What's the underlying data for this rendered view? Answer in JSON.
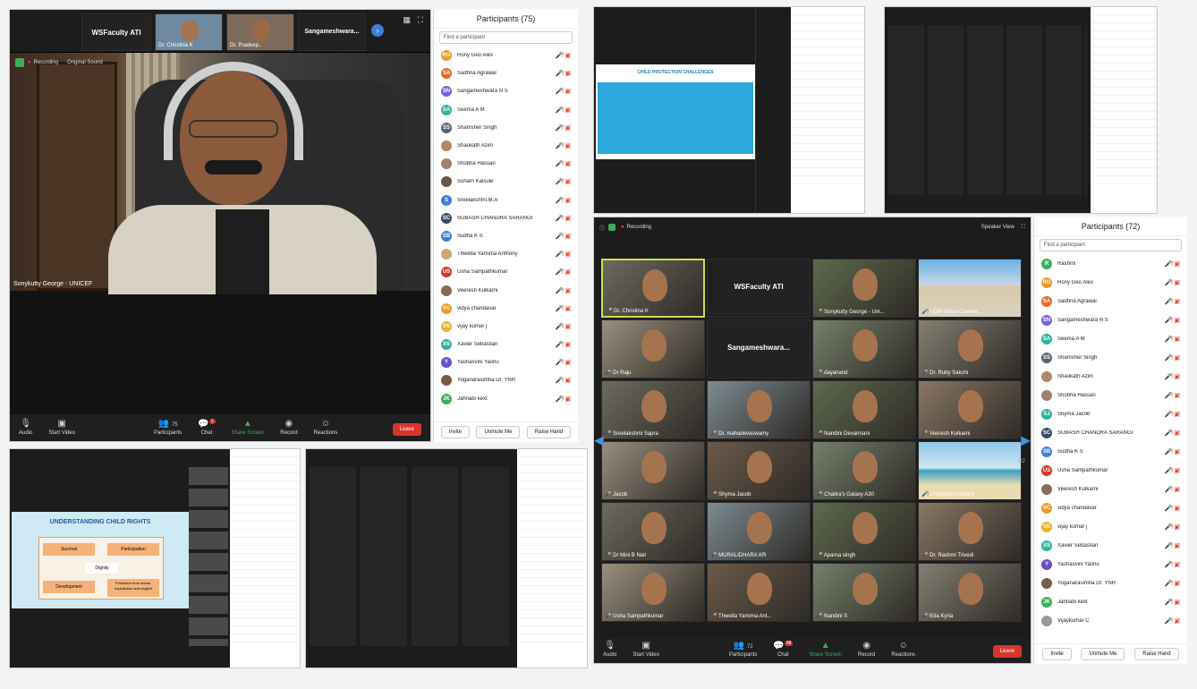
{
  "main": {
    "top_tiles": [
      "WSFaculty ATI",
      "Dr. Christina K",
      "Dr. Pradeep..",
      "Sangameshwara..."
    ],
    "recording": "Recording",
    "original_sound": "Original Sound",
    "speaker_name": "Sonykutty George - UNICEF",
    "toolbar": [
      "Audio",
      "Start Video",
      "Participants",
      "Chat",
      "Share Screen",
      "Record",
      "Reactions"
    ],
    "participants_count": "75",
    "chat_badge": "1",
    "leave": "Leave"
  },
  "participants_a": {
    "title": "Participants (75)",
    "search_placeholder": "Find a participant",
    "rows": [
      {
        "initials": "RG",
        "name": "Rony Geo Alex",
        "color": "#e99a2c"
      },
      {
        "initials": "SA",
        "name": "Sadhna Agrawal",
        "color": "#e06b2a"
      },
      {
        "initials": "SN",
        "name": "Sangameshwara N S",
        "color": "#7b5fd9"
      },
      {
        "initials": "SA",
        "name": "Seema A M",
        "color": "#2fb3a0"
      },
      {
        "initials": "SS",
        "name": "Shamsher Singh",
        "color": "#5b6472"
      },
      {
        "initials": "",
        "name": "Shaukath Azim",
        "color": "#b08766"
      },
      {
        "initials": "",
        "name": "Shobha Hassan",
        "color": "#a08070"
      },
      {
        "initials": "",
        "name": "Soham Kalsule",
        "color": "#6b5544"
      },
      {
        "initials": "S",
        "name": "Sreelakshmi.M.A",
        "color": "#3d7fd9"
      },
      {
        "initials": "SC",
        "name": "SUBASH CHANDRA SARANGI",
        "color": "#3b4b66"
      },
      {
        "initials": "SB",
        "name": "Sudha K S",
        "color": "#3d7fd9"
      },
      {
        "initials": "",
        "name": "Thwetla Yamima Anthony",
        "color": "#c9a878"
      },
      {
        "initials": "US",
        "name": "Usha Sampathkumar",
        "color": "#d9342b"
      },
      {
        "initials": "",
        "name": "Veeresh Kulkarni",
        "color": "#8a6a55"
      },
      {
        "initials": "VC",
        "name": "vidya chandavar",
        "color": "#e99a2c"
      },
      {
        "initials": "VK",
        "name": "vijay kumar j",
        "color": "#e6b32c"
      },
      {
        "initials": "XS",
        "name": "Xavier Sebastian",
        "color": "#2fb3a0"
      },
      {
        "initials": "Y",
        "name": "Yashasvini Yashu",
        "color": "#6b4fc9"
      },
      {
        "initials": "",
        "name": "Yoganarasimha Dr. YNR",
        "color": "#7a5a48"
      },
      {
        "initials": "JK",
        "name": "Jahnabi kext",
        "color": "#3cae5a"
      }
    ],
    "buttons": [
      "Invite",
      "Unmute Me",
      "Raise Hand"
    ]
  },
  "slide_a": {
    "title": "CHILD PROTECTION CHALLENGES"
  },
  "slide_b": {
    "title": "UNDERSTANDING CHILD RIGHTS",
    "boxes": [
      "Survival",
      "Participation",
      "Dignity",
      "Development",
      "Protection from abuse, exploitation and neglect"
    ]
  },
  "gallery": {
    "recording": "Recording",
    "speaker_view": "Speaker View",
    "tiles": [
      {
        "name": "Dr. Christina K",
        "kind": "face"
      },
      {
        "name": "WSFaculty ATI",
        "kind": "text"
      },
      {
        "name": "Sonykutty George - Uni...",
        "kind": "face"
      },
      {
        "name": "UOM Video Confere...",
        "kind": "building"
      },
      {
        "name": "Dr Raju",
        "kind": "face"
      },
      {
        "name": "Sangameshwara...",
        "kind": "text"
      },
      {
        "name": "dayanand",
        "kind": "face"
      },
      {
        "name": "Dr. Ruby Sakshi",
        "kind": "face"
      },
      {
        "name": "Sreelakshmi Sapra",
        "kind": "face"
      },
      {
        "name": "Dr. mahadevaswamy",
        "kind": "face"
      },
      {
        "name": "Nandini Devarmani",
        "kind": "face"
      },
      {
        "name": "Veeresh Kulkarni",
        "kind": "face"
      },
      {
        "name": "Jacob",
        "kind": "face"
      },
      {
        "name": "Shyma Jacob",
        "kind": "face"
      },
      {
        "name": "Chaitra's Galaxy A30",
        "kind": "face"
      },
      {
        "name": "Chaitanya Kulkarni",
        "kind": "beach"
      },
      {
        "name": "Dr Mini B Nair",
        "kind": "face"
      },
      {
        "name": "MURALIDHARA KR",
        "kind": "face"
      },
      {
        "name": "Aparna singh",
        "kind": "face"
      },
      {
        "name": "Dr. Rashmi Trivedi",
        "kind": "face"
      },
      {
        "name": "Usha Sampathkumar",
        "kind": "face"
      },
      {
        "name": "Thwetla Yamima Ant...",
        "kind": "face"
      },
      {
        "name": "Nandini S",
        "kind": "face"
      },
      {
        "name": "Eda Kyria",
        "kind": "face"
      }
    ],
    "page": "1/2",
    "participants_count": "72",
    "chat_badge": "38",
    "toolbar": [
      "Audio",
      "Start Video",
      "Participants",
      "Chat",
      "Share Screen",
      "Record",
      "Reactions"
    ],
    "leave": "Leave"
  },
  "participants_b": {
    "title": "Participants (72)",
    "search_placeholder": "Find a participant",
    "rows": [
      {
        "initials": "R",
        "name": "Rashmi",
        "color": "#3cae5a"
      },
      {
        "initials": "RG",
        "name": "Rony Geo Alex",
        "color": "#e99a2c"
      },
      {
        "initials": "SA",
        "name": "Sadhna Agrawal",
        "color": "#e06b2a"
      },
      {
        "initials": "SN",
        "name": "Sangameshwara N S",
        "color": "#7b5fd9"
      },
      {
        "initials": "SA",
        "name": "Seema A M",
        "color": "#2fb3a0"
      },
      {
        "initials": "SS",
        "name": "Shamsher Singh",
        "color": "#5b6472"
      },
      {
        "initials": "",
        "name": "Shaukath Azim",
        "color": "#b08766"
      },
      {
        "initials": "",
        "name": "Shobha Hassan",
        "color": "#a08070"
      },
      {
        "initials": "SJ",
        "name": "Shyma Jacob",
        "color": "#2fb3a0"
      },
      {
        "initials": "SC",
        "name": "SUBASH CHANDRA SARANGI",
        "color": "#3b4b66"
      },
      {
        "initials": "SB",
        "name": "Sudha K S",
        "color": "#3d7fd9"
      },
      {
        "initials": "US",
        "name": "Usha Sampathkumar",
        "color": "#d9342b"
      },
      {
        "initials": "",
        "name": "Veeresh Kulkarni",
        "color": "#8a6a55"
      },
      {
        "initials": "VC",
        "name": "vidya chandavar",
        "color": "#e99a2c"
      },
      {
        "initials": "VK",
        "name": "vijay kumar j",
        "color": "#e6b32c"
      },
      {
        "initials": "XS",
        "name": "Xavier Sebastian",
        "color": "#2fb3a0"
      },
      {
        "initials": "Y",
        "name": "Yashasvini Yashu",
        "color": "#6b4fc9"
      },
      {
        "initials": "",
        "name": "Yoganarasimha Dr. YNR",
        "color": "#7a5a48"
      },
      {
        "initials": "JK",
        "name": "Jahnabi kext",
        "color": "#3cae5a"
      },
      {
        "initials": "",
        "name": "Vijaykumar C",
        "color": "#9a9a9a"
      }
    ],
    "buttons": [
      "Invite",
      "Unmute Me",
      "Raise Hand"
    ]
  }
}
